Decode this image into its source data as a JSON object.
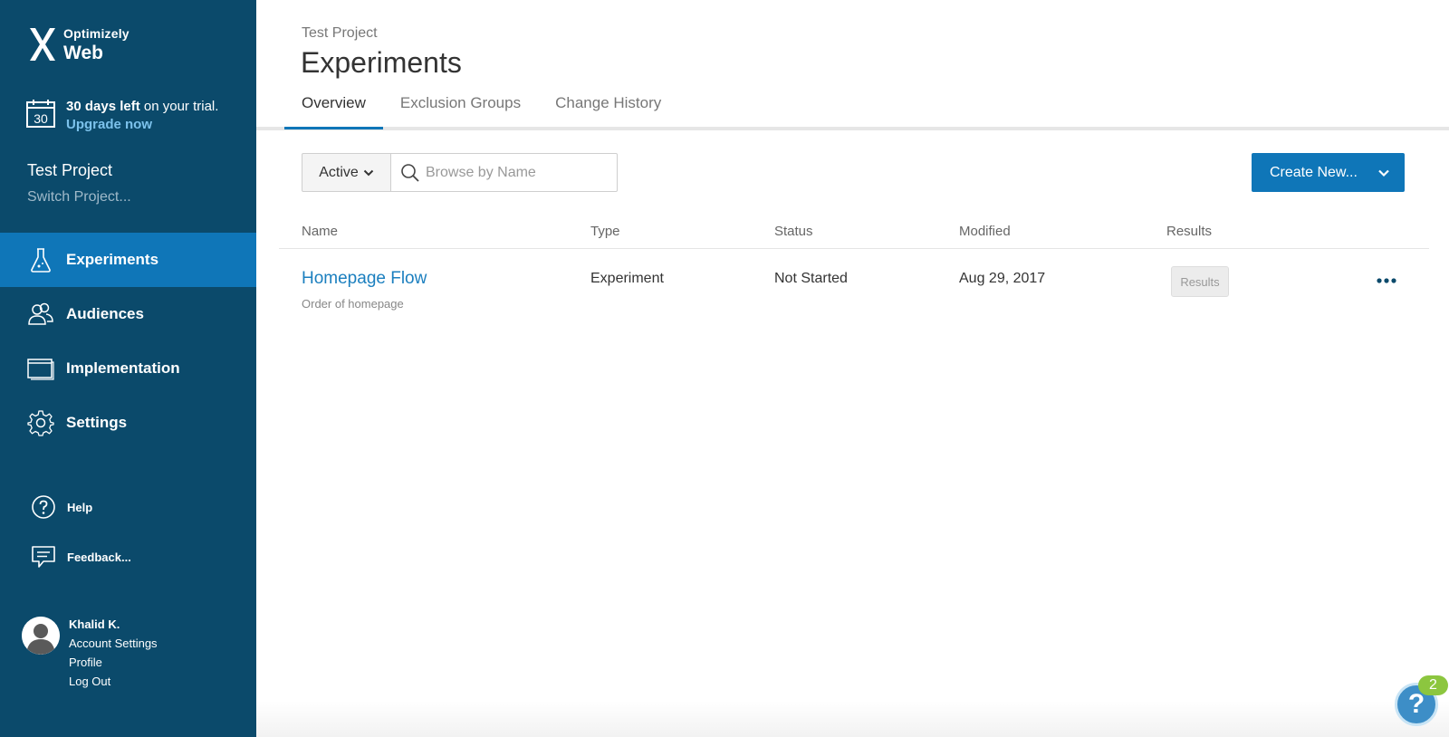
{
  "brand": {
    "top": "Optimizely",
    "bottom": "Web"
  },
  "trial": {
    "calendar_day": "30",
    "days_left": "30 days left",
    "rest": " on your trial.",
    "upgrade": "Upgrade now"
  },
  "project": {
    "name": "Test Project",
    "switch": "Switch Project..."
  },
  "nav": [
    {
      "label": "Experiments",
      "icon": "flask-icon",
      "active": true
    },
    {
      "label": "Audiences",
      "icon": "people-icon",
      "active": false
    },
    {
      "label": "Implementation",
      "icon": "window-icon",
      "active": false
    },
    {
      "label": "Settings",
      "icon": "gear-icon",
      "active": false
    }
  ],
  "util": {
    "help": "Help",
    "feedback": "Feedback..."
  },
  "user": {
    "name": "Khalid K.",
    "account_settings": "Account Settings",
    "profile": "Profile",
    "logout": "Log Out"
  },
  "header": {
    "breadcrumb": "Test Project",
    "title": "Experiments"
  },
  "tabs": [
    "Overview",
    "Exclusion Groups",
    "Change History"
  ],
  "filter": {
    "status": "Active",
    "search_placeholder": "Browse by Name"
  },
  "create_button": "Create New...",
  "table": {
    "columns": [
      "Name",
      "Type",
      "Status",
      "Modified",
      "Results"
    ],
    "rows": [
      {
        "name": "Homepage Flow",
        "description": "Order of homepage",
        "type": "Experiment",
        "status": "Not Started",
        "modified": "Aug 29, 2017",
        "results": "Results"
      }
    ]
  },
  "help_widget": {
    "icon": "?",
    "badge": "2"
  },
  "colors": {
    "sidebar": "#0b4a6b",
    "accent": "#0f76b8",
    "link": "#1b7fbf",
    "badge": "#8cc63f"
  }
}
